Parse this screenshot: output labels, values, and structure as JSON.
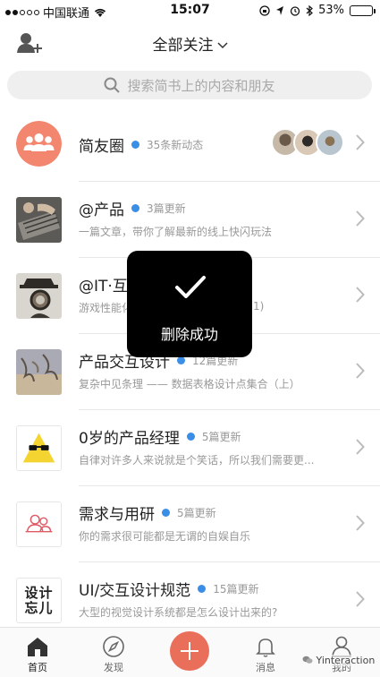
{
  "status_bar": {
    "carrier": "中国联通",
    "time": "15:07",
    "battery": "53%",
    "battery_level": 0.53
  },
  "nav": {
    "title": "全部关注",
    "chevron": "⌄"
  },
  "search": {
    "placeholder": "搜索简书上的内容和朋友"
  },
  "list": [
    {
      "title": "简友圈",
      "update": "35条新动态",
      "desc": ""
    },
    {
      "title": "@产品",
      "update": "3篇更新",
      "desc": "一篇文章，带你了解最新的线上快闪玩法"
    },
    {
      "title": "@IT·互",
      "update": "",
      "desc": "游戏性能化"
    },
    {
      "title": "产品交互设计",
      "update": "12篇更新",
      "desc": "复杂中见条理 —— 数据表格设计点集合（上）"
    },
    {
      "title": "0岁的产品经理",
      "update": "5篇更新",
      "desc": "自律对许多人来说就是个笑话，所以我们需要更..."
    },
    {
      "title": "需求与用研",
      "update": "5篇更新",
      "desc": "你的需求很可能都是无谓的自娱自乐"
    },
    {
      "title": "UI/交互设计规范",
      "update": "15篇更新",
      "desc": "大型的视觉设计系统都是怎么设计出来的?"
    }
  ],
  "list_tail_fragment": "1)",
  "icon_text_design": "设计\n忘儿",
  "toast": {
    "text": "删除成功"
  },
  "tabbar": {
    "home": "首页",
    "discover": "发现",
    "messages": "消息",
    "me": "我的"
  },
  "watermark": "Yinteraction",
  "colors": {
    "accent": "#ea6f5a",
    "blue_dot": "#3a8ee6",
    "battery": "#2ecc40"
  }
}
